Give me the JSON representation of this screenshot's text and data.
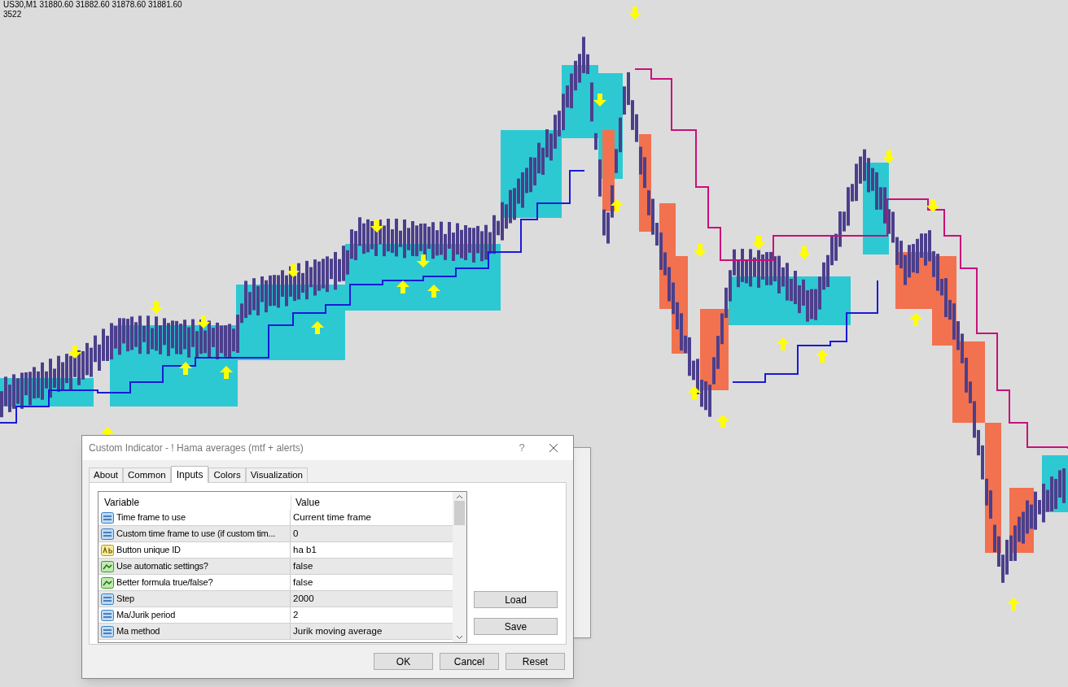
{
  "chart_header": {
    "symbol_info": "US30,M1  31880.60 31882.60 31878.60 31881.60",
    "bar_count": "3522"
  },
  "dialog": {
    "title": "Custom Indicator - ! Hama averages (mtf + alerts)",
    "help_label": "?",
    "tabs": [
      {
        "label": "About",
        "selected": false
      },
      {
        "label": "Common",
        "selected": false
      },
      {
        "label": "Inputs",
        "selected": true
      },
      {
        "label": "Colors",
        "selected": false
      },
      {
        "label": "Visualization",
        "selected": false
      }
    ],
    "table": {
      "columns": [
        "Variable",
        "Value"
      ],
      "rows": [
        {
          "kind": "number",
          "variable": "Time frame to use",
          "value": "Current time frame"
        },
        {
          "kind": "number",
          "variable": "Custom time frame to use (if custom tim...",
          "value": "0"
        },
        {
          "kind": "string",
          "variable": "Button unique ID",
          "value": "ha b1"
        },
        {
          "kind": "bool",
          "variable": "Use automatic settings?",
          "value": "false"
        },
        {
          "kind": "bool",
          "variable": "Better formula true/false?",
          "value": "false"
        },
        {
          "kind": "number",
          "variable": "Step",
          "value": "2000"
        },
        {
          "kind": "number",
          "variable": "Ma/Jurik period",
          "value": "2"
        },
        {
          "kind": "number",
          "variable": "Ma method",
          "value": "Jurik moving average"
        }
      ]
    },
    "side_buttons": [
      "Load",
      "Save"
    ],
    "bottom_buttons": [
      "OK",
      "Cancel",
      "Reset"
    ]
  }
}
